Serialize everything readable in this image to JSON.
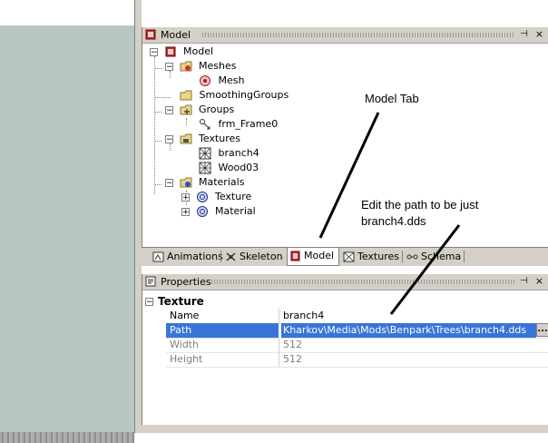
{
  "model_panel": {
    "title": "Model",
    "pin_glyph": "⊣",
    "close_glyph": "×",
    "tree": {
      "root": "Model",
      "meshes": "Meshes",
      "mesh": "Mesh",
      "smoothing_groups": "SmoothingGroups",
      "groups": "Groups",
      "frame": "frm_Frame0",
      "textures": "Textures",
      "texture_1": "branch4",
      "texture_2": "Wood03",
      "materials": "Materials",
      "material_texture": "Texture",
      "material_material": "Material"
    },
    "tabs": [
      "Animations",
      "Skeleton",
      "Model",
      "Textures",
      "Schema"
    ],
    "active_tab": "Model"
  },
  "properties_panel": {
    "title": "Properties",
    "group": "Texture",
    "rows": [
      {
        "name": "Name",
        "value": "branch4"
      },
      {
        "name": "Path",
        "value": "Kharkov\\Media\\Mods\\Benpark\\Trees\\branch4.dds"
      },
      {
        "name": "Width",
        "value": "512"
      },
      {
        "name": "Height",
        "value": "512"
      }
    ],
    "ellipsis_label": "..."
  },
  "annotations": {
    "model_tab_note": "Model Tab",
    "path_note_line1": "Edit the path to be just",
    "path_note_line2": "branch4.dds"
  },
  "colors": {
    "chrome": "#d4d0c8",
    "selection": "#3875d7",
    "viewport": "#b8c7c3"
  }
}
